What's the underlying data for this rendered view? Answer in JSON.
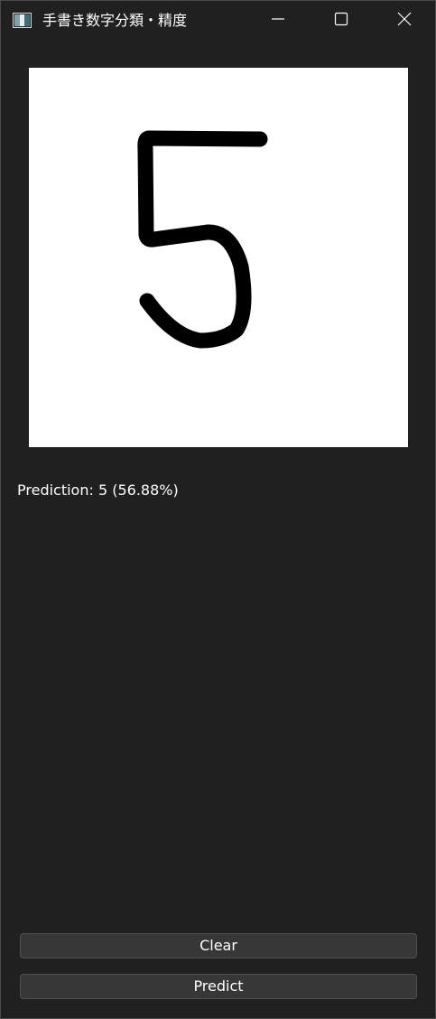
{
  "window": {
    "title": "手書き数字分類・精度",
    "app_icon": "image-window-icon",
    "controls": {
      "minimize_icon": "minimize-icon",
      "maximize_icon": "maximize-icon",
      "close_icon": "close-icon"
    }
  },
  "canvas": {
    "background": "#ffffff",
    "stroke_color": "#000000",
    "drawn_digit": "5"
  },
  "result": {
    "prediction_text": "Prediction: 5 (56.88%)"
  },
  "buttons": {
    "clear_label": "Clear",
    "predict_label": "Predict"
  }
}
